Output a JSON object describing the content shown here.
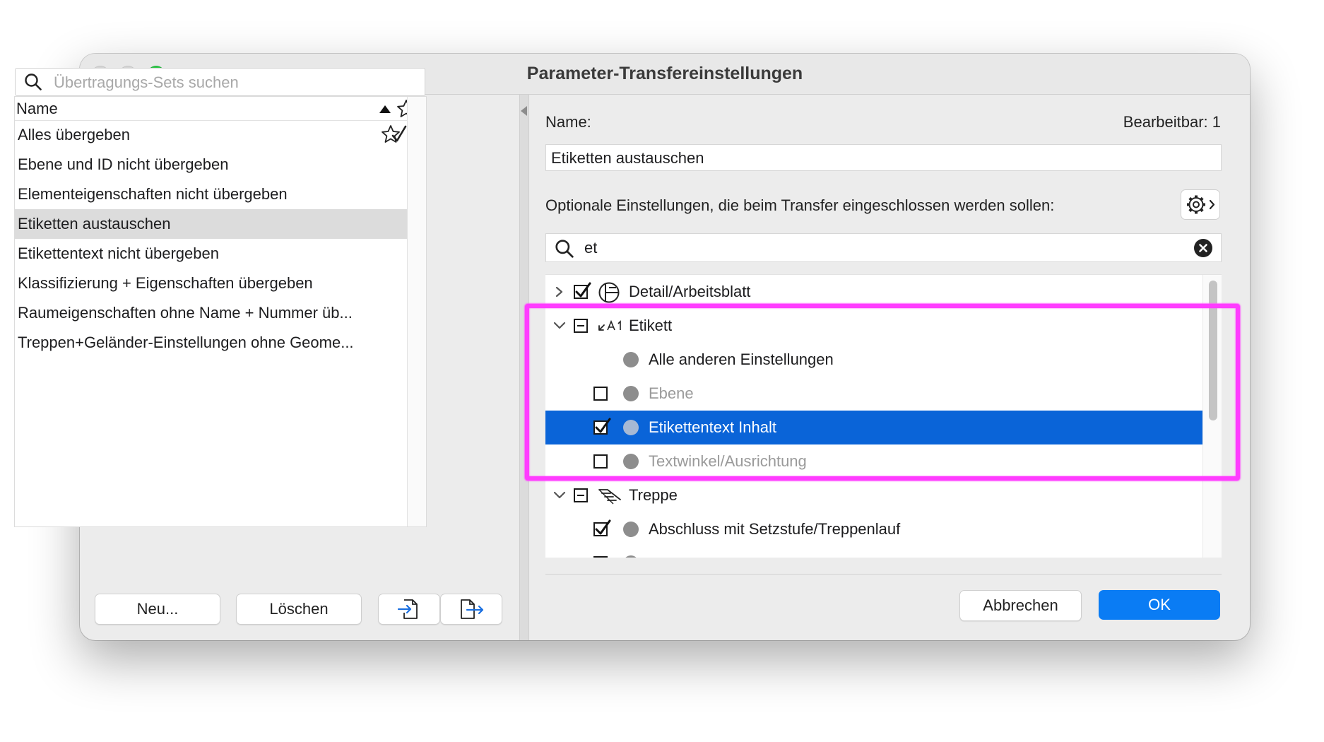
{
  "window": {
    "title": "Parameter-Transfereinstellungen"
  },
  "left": {
    "search_placeholder": "Übertragungs-Sets suchen",
    "column_header": "Name",
    "items": [
      {
        "label": "Alles übergeben",
        "favorite": true
      },
      {
        "label": "Ebene und ID nicht übergeben"
      },
      {
        "label": "Elementeigenschaften nicht übergeben"
      },
      {
        "label": "Etiketten austauschen",
        "selected": true
      },
      {
        "label": "Etikettentext nicht übergeben"
      },
      {
        "label": "Klassifizierung + Eigenschaften übergeben"
      },
      {
        "label": "Raumeigenschaften ohne Name + Nummer üb..."
      },
      {
        "label": "Treppen+Geländer-Einstellungen ohne Geome..."
      }
    ],
    "buttons": {
      "new": "Neu...",
      "delete": "Löschen"
    }
  },
  "right": {
    "name_label": "Name:",
    "editable_label": "Bearbeitbar: 1",
    "name_value": "Etiketten austauschen",
    "optional_label": "Optionale Einstellungen, die beim Transfer eingeschlossen werden sollen:",
    "filter_value": "et",
    "tree": [
      {
        "label": "Detail/Arbeitsblatt",
        "level": 0,
        "expanded": false,
        "check": "checked"
      },
      {
        "label": "Etikett",
        "level": 0,
        "expanded": true,
        "check": "mixed"
      },
      {
        "label": "Alle anderen Einstellungen",
        "level": 1,
        "check": "none"
      },
      {
        "label": "Ebene",
        "level": 1,
        "check": "unchecked",
        "dimmed": true
      },
      {
        "label": "Etikettentext Inhalt",
        "level": 1,
        "check": "checked",
        "selected": true
      },
      {
        "label": "Textwinkel/Ausrichtung",
        "level": 1,
        "check": "unchecked",
        "dimmed": true
      },
      {
        "label": "Treppe",
        "level": 0,
        "expanded": true,
        "check": "mixed"
      },
      {
        "label": "Abschluss mit Setzstufe/Treppenlauf",
        "level": 1,
        "check": "checked"
      }
    ],
    "buttons": {
      "cancel": "Abbrechen",
      "ok": "OK"
    }
  },
  "colors": {
    "selection": "#0a64d8",
    "ok_button": "#0a7cf4",
    "highlight": "#ff3cff"
  }
}
